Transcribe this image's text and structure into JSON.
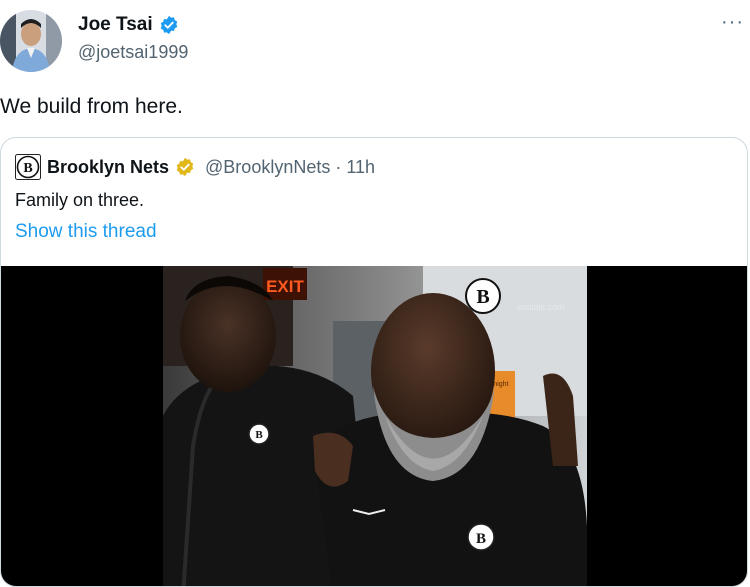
{
  "author": {
    "name": "Joe Tsai",
    "handle": "@joetsai1999",
    "verified_color": "#1d9bf0"
  },
  "more_label": "···",
  "tweet": {
    "text": "We build from here."
  },
  "quoted": {
    "name": "Brooklyn Nets",
    "handle_time": "@BrooklynNets · 11h",
    "verified_color": "#e2b719",
    "text": "Family on three.",
    "show_thread": "Show this thread"
  },
  "media": {
    "logo_letter": "B",
    "exit_sign": "EXIT",
    "watermark": "socials.com",
    "orange_sign": "tonight"
  },
  "colors": {
    "link": "#1d9bf0",
    "secondary_text": "#536471",
    "border": "#cfd9de"
  }
}
